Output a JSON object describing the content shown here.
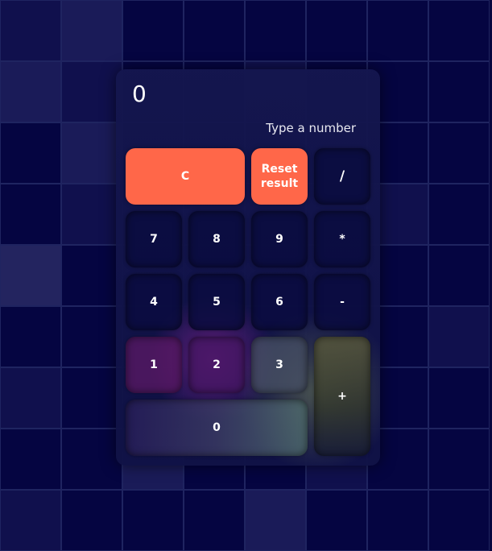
{
  "display": {
    "value": "0",
    "hint": "Type a number"
  },
  "keys": {
    "clear": "C",
    "reset": "Reset result",
    "divide": "/",
    "seven": "7",
    "eight": "8",
    "nine": "9",
    "multiply": "*",
    "four": "4",
    "five": "5",
    "six": "6",
    "subtract": "-",
    "one": "1",
    "two": "2",
    "three": "3",
    "add": "+",
    "zero": "0"
  },
  "colors": {
    "accent": "#ff6749",
    "background": "#06063e",
    "panel": "#14164e"
  }
}
